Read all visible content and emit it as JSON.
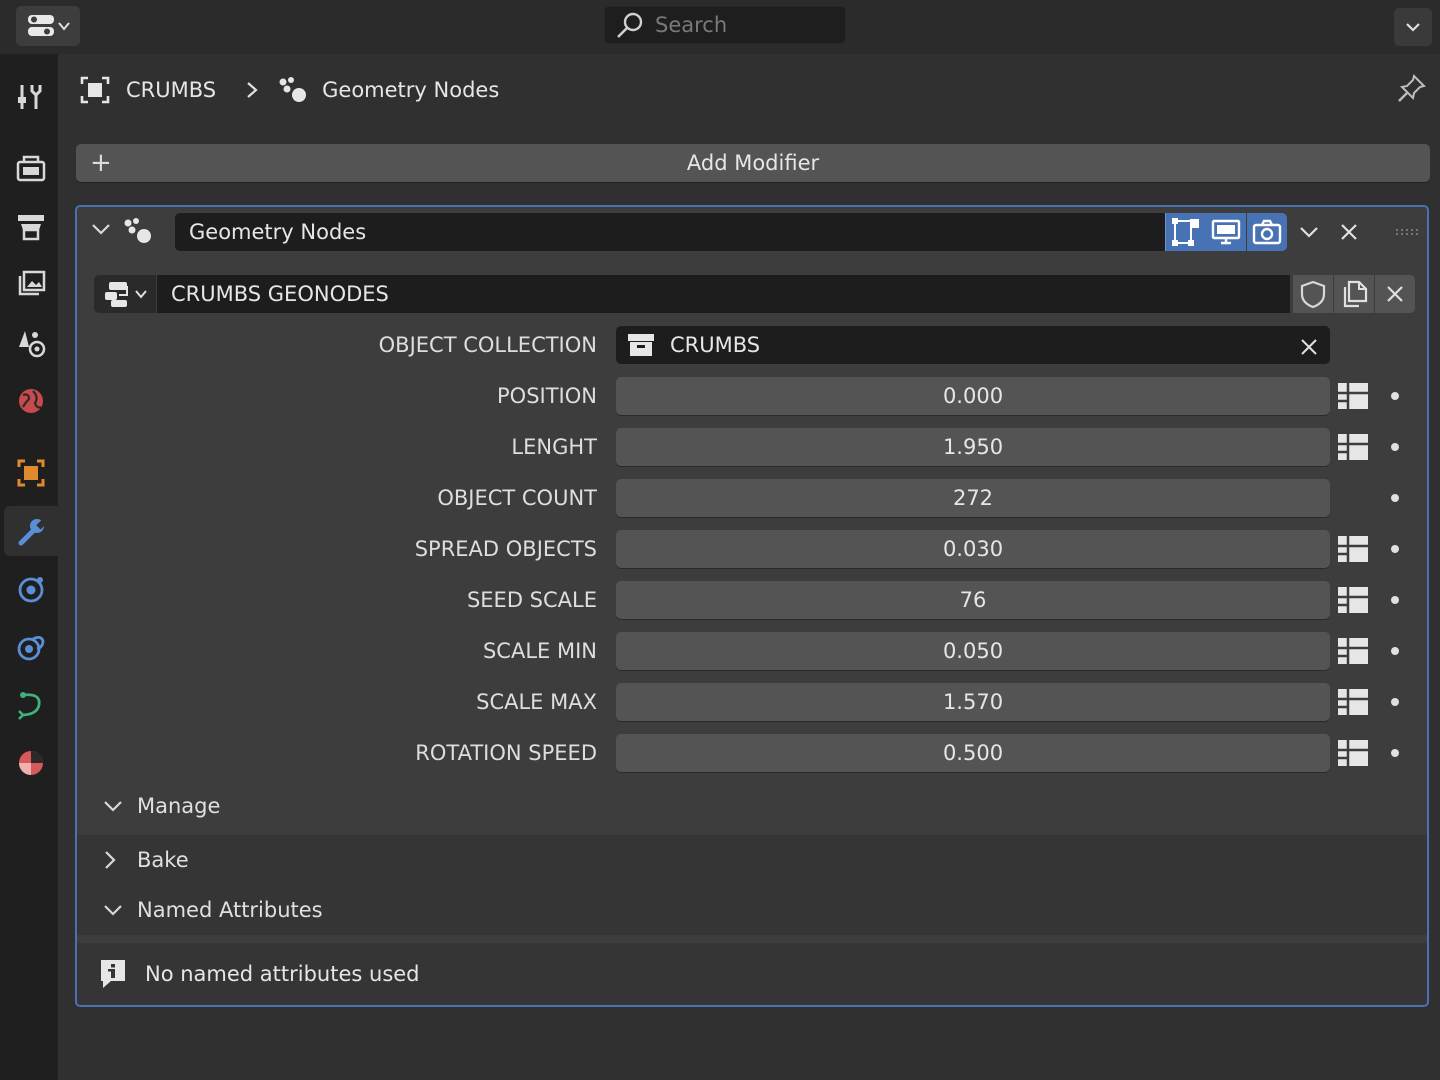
{
  "topbar": {
    "search_placeholder": "Search"
  },
  "breadcrumb": {
    "object": "CRUMBS",
    "modifier": "Geometry Nodes"
  },
  "add_modifier_label": "Add Modifier",
  "modifier": {
    "name": "Geometry Nodes",
    "node_group": "CRUMBS GEONODES",
    "properties": [
      {
        "label": "OBJECT COLLECTION",
        "value": "CRUMBS"
      },
      {
        "label": "POSITION",
        "value": "0.000"
      },
      {
        "label": "LENGHT",
        "value": "1.950"
      },
      {
        "label": "OBJECT COUNT",
        "value": "272"
      },
      {
        "label": "SPREAD OBJECTS",
        "value": "0.030"
      },
      {
        "label": "SEED SCALE",
        "value": "76"
      },
      {
        "label": "SCALE MIN",
        "value": "0.050"
      },
      {
        "label": "SCALE MAX",
        "value": "1.570"
      },
      {
        "label": "ROTATION SPEED",
        "value": "0.500"
      }
    ],
    "subpanels": {
      "manage": "Manage",
      "bake": "Bake",
      "named_attributes": "Named Attributes"
    },
    "info_text": "No named attributes used"
  },
  "colors": {
    "accent": "#4772b3",
    "background": "#303030",
    "panel": "#3d3d3d",
    "field": "#545454"
  }
}
